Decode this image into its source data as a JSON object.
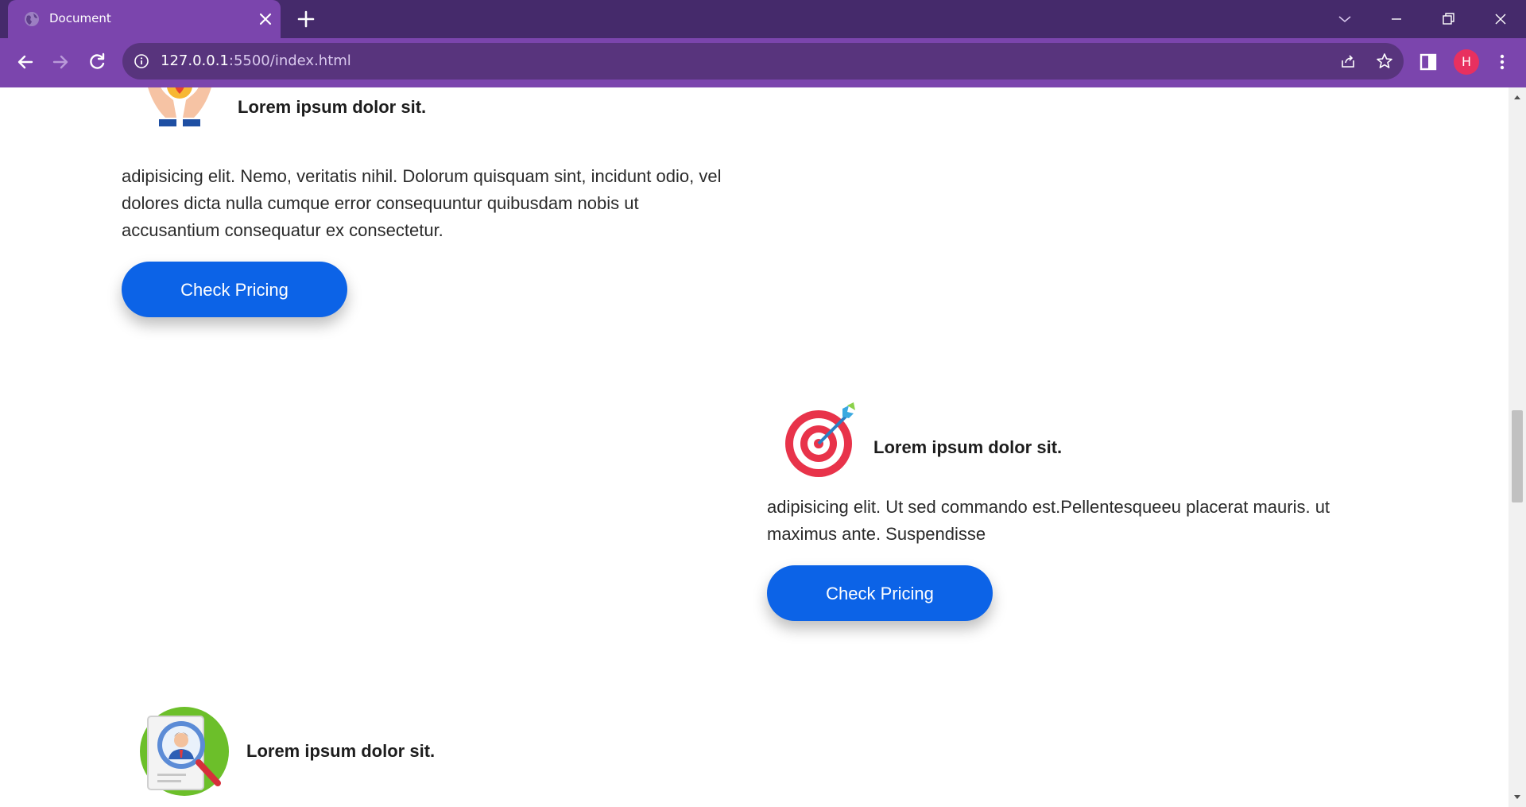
{
  "browser": {
    "tab": {
      "title": "Document"
    },
    "address": {
      "host": "127.0.0.1",
      "rest": ":5500/index.html"
    },
    "profile": {
      "initial": "H"
    },
    "icons": [
      "globe-icon",
      "close-icon",
      "plus-icon",
      "chevron-down-icon",
      "minimize-icon",
      "restore-icon",
      "window-close-icon",
      "back-icon",
      "forward-icon",
      "reload-icon",
      "info-icon",
      "share-icon",
      "star-icon",
      "side-panel-icon",
      "more-icon"
    ]
  },
  "features": [
    {
      "title": "Lorem ipsum dolor sit.",
      "text": "adipisicing elit. Nemo, veritatis nihil. Dolorum quisquam sint, incidunt odio, vel dolores dicta nulla cumque error consequuntur quibusdam nobis ut accusantium consequatur ex consectetur.",
      "button": "Check Pricing",
      "icon": "hands-heart-icon"
    },
    {
      "title": "Lorem ipsum dolor sit.",
      "text": "adipisicing elit. Ut sed commando est.Pellentesqueeu placerat mauris. ut maximus ante. Suspendisse",
      "button": "Check Pricing",
      "icon": "target-arrow-icon"
    },
    {
      "title": "Lorem ipsum dolor sit.",
      "icon": "candidate-search-icon"
    }
  ],
  "colors": {
    "tabbar": "#452a6b",
    "toolbar": "#7b45ad",
    "omnibox": "#58347d",
    "button": "#0c63e7",
    "avatar": "#e8305f"
  }
}
